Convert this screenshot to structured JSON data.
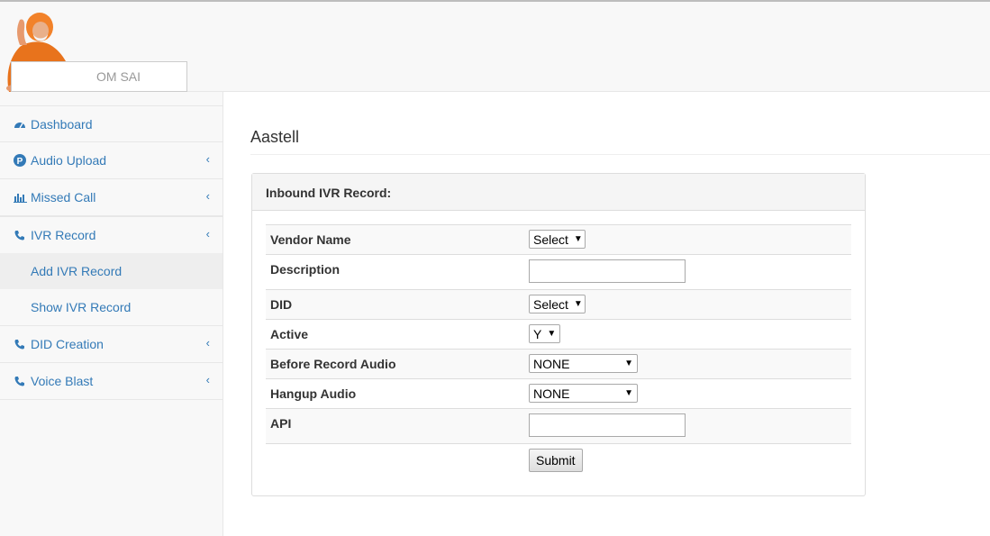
{
  "search": {
    "placeholder": "OM SAI"
  },
  "sidebar": {
    "items": [
      {
        "label": "Dashboard",
        "icon": "dashboard-icon"
      },
      {
        "label": "Audio Upload",
        "icon": "p-circle-icon"
      },
      {
        "label": "Missed Call",
        "icon": "bar-chart-icon"
      },
      {
        "label": "IVR Record",
        "icon": "phone-icon"
      },
      {
        "label": "DID Creation",
        "icon": "phone-icon"
      },
      {
        "label": "Voice Blast",
        "icon": "phone-icon"
      }
    ],
    "ivr_sub": [
      "Add IVR Record",
      "Show IVR Record"
    ]
  },
  "main": {
    "title": "Aastell",
    "panel_title": "Inbound IVR Record:",
    "form": {
      "vendor_label": "Vendor Name",
      "vendor_value": "Select",
      "description_label": "Description",
      "description_value": "",
      "did_label": "DID",
      "did_value": "Select",
      "active_label": "Active",
      "active_value": "Y",
      "before_label": "Before Record Audio",
      "before_value": "NONE",
      "hangup_label": "Hangup Audio",
      "hangup_value": "NONE",
      "api_label": "API",
      "api_value": "",
      "submit_label": "Submit"
    }
  },
  "colors": {
    "link": "#337ab7",
    "sidebar_bg": "#f8f8f8",
    "active_bg": "#eeeeee"
  }
}
